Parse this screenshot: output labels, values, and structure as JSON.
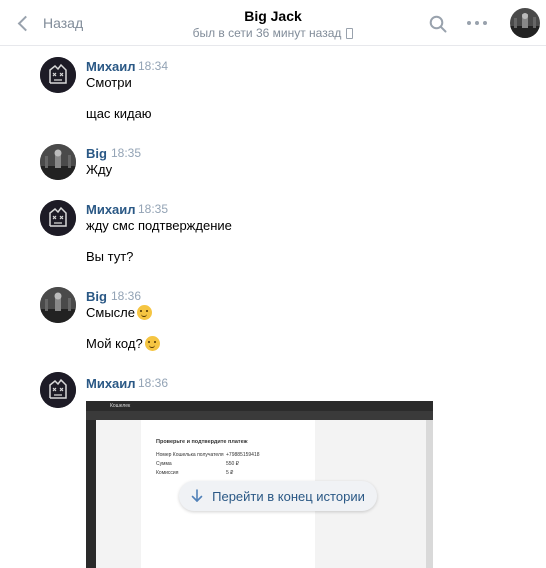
{
  "header": {
    "back_label": "Назад",
    "title": "Big Jack",
    "subtitle": "был в сети 36 минут назад"
  },
  "messages": [
    {
      "author": "Михаил",
      "time": "18:34",
      "lines": [
        "Смотри",
        "щас кидаю"
      ]
    },
    {
      "author": "Big",
      "time": "18:35",
      "lines": [
        "Жду"
      ]
    },
    {
      "author": "Михаил",
      "time": "18:35",
      "lines": [
        "жду смс подтверждение",
        "Вы тут?"
      ]
    },
    {
      "author": "Big",
      "time": "18:36",
      "lines": [
        "Смысле",
        "Мой код?"
      ],
      "emojis": [
        "thinking-face",
        "rolling-laughing-face"
      ]
    },
    {
      "author": "Михаил",
      "time": "18:36",
      "attachment": "screenshot-image"
    }
  ],
  "screenshot": {
    "tab_title": "Кошелек",
    "heading": "Проверьте и подтвердите платеж",
    "rows": [
      {
        "label": "Номер Кошелька получателя",
        "value": "+79885159418"
      },
      {
        "label": "Сумма",
        "value": "550 ₽"
      },
      {
        "label": "Комиссия",
        "value": "5 ₽"
      }
    ]
  },
  "jump_button": {
    "label": "Перейти в конец истории"
  }
}
